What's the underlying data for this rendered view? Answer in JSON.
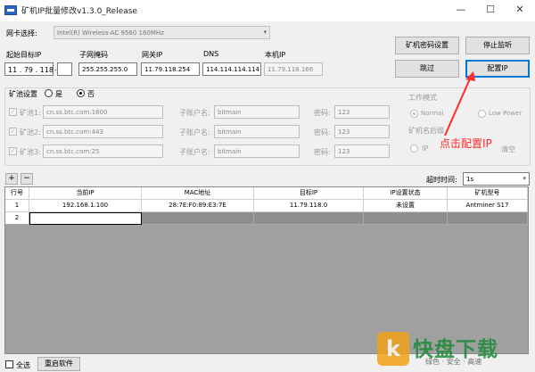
{
  "window": {
    "title": "矿机IP批量修改v1.3.0_Release",
    "min_glyph": "—",
    "max_glyph": "☐",
    "close_glyph": "✕"
  },
  "nic": {
    "label": "网卡选择:",
    "value": "Intel(R) Wireless-AC 9560 160MHz"
  },
  "network": {
    "start_ip": {
      "label": "起始目标IP",
      "seg1": "11",
      "seg2": "79",
      "seg3": "118",
      "seg4": ""
    },
    "mask": {
      "label": "子网掩码",
      "value": "255.255.255.0"
    },
    "gateway": {
      "label": "网关IP",
      "value": "11.79.118.254"
    },
    "dns": {
      "label": "DNS",
      "value": "114.114.114.114"
    },
    "local_ip": {
      "label": "本机IP",
      "value": "11.79.118.166"
    }
  },
  "buttons": {
    "miner_password": "矿机密码设置",
    "stop_listen": "停止监听",
    "skip": "跳过",
    "config_ip": "配置IP",
    "restart": "重启软件",
    "plus": "+",
    "minus": "−"
  },
  "pool": {
    "label": "矿池设置",
    "yes": "是",
    "no": "否",
    "sub_account_label": "子账户名:",
    "password_label": "密码:",
    "rows": [
      {
        "name": "矿池1:",
        "url": "cn.ss.btc.com:1800",
        "sub": "bitmain",
        "pwd": "123"
      },
      {
        "name": "矿池2:",
        "url": "cn.ss.btc.com:443",
        "sub": "bitmain",
        "pwd": "123"
      },
      {
        "name": "矿池3:",
        "url": "cn.ss.btc.com:25",
        "sub": "bitmain",
        "pwd": "123"
      }
    ],
    "check_glyph": "✓"
  },
  "work_mode": {
    "label": "工作模式",
    "normal": "Normal",
    "low_power": "Low Power",
    "suffix_label": "矿机名后缀",
    "ip_option": "IP",
    "clear_option": "清空"
  },
  "timeout": {
    "label": "超时时间:",
    "value": "1s",
    "arrow": "▾"
  },
  "table": {
    "headers": [
      "行号",
      "当前IP",
      "MAC地址",
      "目标IP",
      "IP设置状态",
      "矿机型号"
    ],
    "rows": [
      [
        "1",
        "192.168.1.100",
        "28:7E:F0:89:E3:7E",
        "11.79.118.0",
        "未设置",
        "Antminer S17"
      ],
      [
        "2",
        "",
        "",
        "",
        "",
        ""
      ]
    ]
  },
  "footer": {
    "select_all": "全选"
  },
  "annotation": {
    "text": "点击配置IP",
    "color": "#ff2a2a"
  },
  "watermark": {
    "logo_glyph": "k",
    "brand": "快盘下载",
    "slogan": "绿色 · 安全 · 高速"
  }
}
